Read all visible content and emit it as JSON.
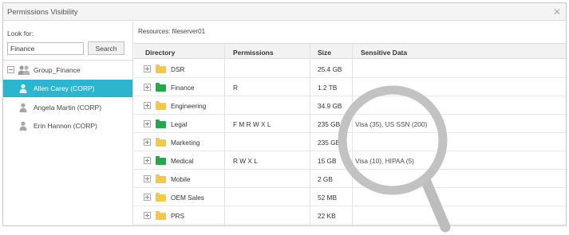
{
  "window": {
    "title": "Permissions Visibility",
    "close_icon": "close-icon"
  },
  "search": {
    "label": "Look for:",
    "value": "Finance",
    "button": "Search"
  },
  "tree": {
    "group": "Group_Finance",
    "users": [
      "Allen Carey (CORP)",
      "Angela Martin (CORP)",
      "Erin Hannon (CORP)"
    ],
    "selected": "Allen Carey (CORP)"
  },
  "resources": "Resources: fileserver01",
  "table": {
    "headers": [
      "Directory",
      "Permissions",
      "Size",
      "Sensitive Data"
    ],
    "rows": [
      {
        "directory": "DSR",
        "permissions": "",
        "size": "25.4 GB",
        "sensitive": "",
        "folder_color": "#f3c845"
      },
      {
        "directory": "Finance",
        "permissions": "R",
        "size": "1.2 TB",
        "sensitive": "",
        "folder_color": "#25a84b"
      },
      {
        "directory": "Engineering",
        "permissions": "",
        "size": "34.9 GB",
        "sensitive": "",
        "folder_color": "#f3c845"
      },
      {
        "directory": "Legal",
        "permissions": "F M R W X L",
        "size": "235 GB",
        "sensitive": "Visa (35), US SSN (200)",
        "folder_color": "#25a84b"
      },
      {
        "directory": "Marketing",
        "permissions": "",
        "size": "235 GB",
        "sensitive": "",
        "folder_color": "#f3c845"
      },
      {
        "directory": "Medical",
        "permissions": "R W X L",
        "size": "15 GB",
        "sensitive": "Visa (10), HIPAA (5)",
        "folder_color": "#25a84b"
      },
      {
        "directory": "Mobile",
        "permissions": "",
        "size": "2 GB",
        "sensitive": "",
        "folder_color": "#f3c845"
      },
      {
        "directory": "OEM Sales",
        "permissions": "",
        "size": "52 MB",
        "sensitive": "",
        "folder_color": "#f3c845"
      },
      {
        "directory": "PRS",
        "permissions": "",
        "size": "22 KB",
        "sensitive": "",
        "folder_color": "#f3c845"
      }
    ]
  },
  "colors": {
    "selected": "#2bb6cd",
    "folder_green": "#25a84b",
    "folder_yellow": "#f3c845",
    "magnifier": "#bfbfbf"
  },
  "overlay": {
    "icon": "magnifier-icon"
  }
}
